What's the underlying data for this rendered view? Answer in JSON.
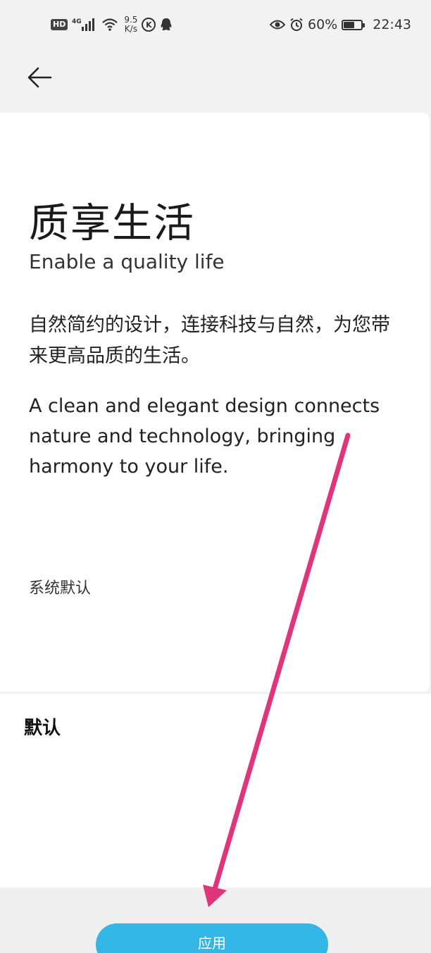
{
  "status_bar": {
    "hd_badge": "HD",
    "network_type": "4G",
    "net_speed_value": "9.5",
    "net_speed_unit": "K/s",
    "k_badge": "K",
    "battery_percent_text": "60%",
    "battery_level": 0.6,
    "time": "22:43",
    "icons": [
      "signal-icon",
      "wifi-icon",
      "k-icon",
      "qq-icon",
      "eye-icon",
      "alarm-icon",
      "battery-icon"
    ]
  },
  "header": {
    "back_icon": "arrow-left-icon"
  },
  "preview": {
    "title": "质享生活",
    "subtitle": "Enable a quality life",
    "description_cn": "自然简约的设计，连接科技与自然，为您带来更高品质的生活。",
    "description_en": "A clean and elegant design connects nature and technology, bringing harmony to your life.",
    "font_name": "系统默认"
  },
  "option": {
    "selected_name": "默认"
  },
  "bottom_bar": {
    "apply_label": "应用"
  },
  "annotation": {
    "arrow_color": "#e0357a"
  },
  "colors": {
    "accent": "#33b5e5",
    "background": "#f2f2f2",
    "card": "#ffffff"
  }
}
